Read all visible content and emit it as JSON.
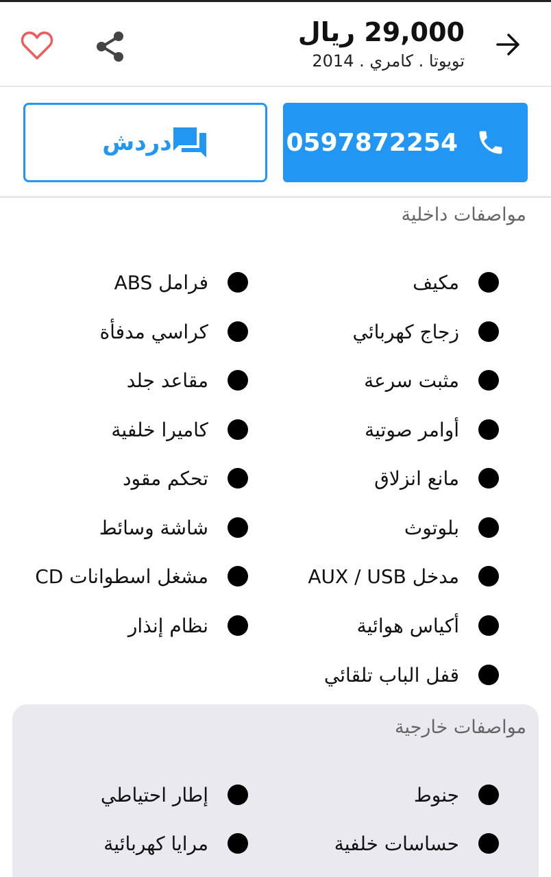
{
  "header": {
    "price": "29,000 ريال",
    "subtitle": "تويوتا . كامري . 2014"
  },
  "actions": {
    "phone": "0597872254",
    "chat_label": "دردش"
  },
  "colors": {
    "accent": "#2196f3",
    "favorite": "#f05a5a",
    "exterior_bg": "#e9e9ef"
  },
  "icons": [
    "arrow-right-icon",
    "share-icon",
    "heart-icon",
    "phone-icon",
    "chat-icon",
    "bullet-icon"
  ],
  "interior": {
    "title": "مواصفات داخلية",
    "features": [
      "مكيف",
      "فرامل ABS",
      "زجاج كهربائي",
      "كراسي مدفأة",
      "مثبت سرعة",
      "مقاعد جلد",
      "أوامر صوتية",
      "كاميرا خلفية",
      "مانع انزلاق",
      "تحكم مقود",
      "بلوتوث",
      "شاشة وسائط",
      "مدخل AUX / USB",
      "مشغل اسطوانات CD",
      "أكياس هوائية",
      "نظام إنذار",
      "قفل الباب تلقائي"
    ]
  },
  "exterior": {
    "title": "مواصفات خارجية",
    "features": [
      "جنوط",
      "إطار احتياطي",
      "حساسات خلفية",
      "مرايا كهربائية"
    ]
  }
}
